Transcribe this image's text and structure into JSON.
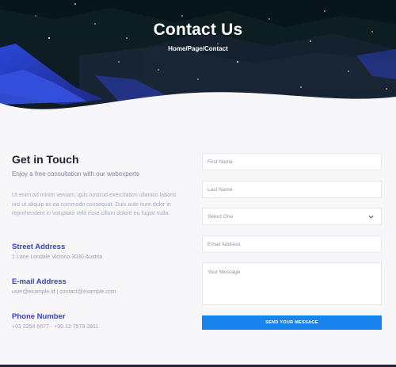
{
  "hero": {
    "title": "Contact Us",
    "breadcrumb": "Home/Page/Contact"
  },
  "contact_info": {
    "title": "Get in Touch",
    "subtitle": "Enjoy a free consultation with our webexperts",
    "body": "Ut enim ad minim veniam, quis nostrud exercitation ullamco laboris nisi ut aliquip ex ea commodo consequat. Duis aute irure dolor in reprehenderit in voluptate velit esse cillum dolore eu fugiat nulla.",
    "street_label": "Street Address",
    "street_value": "1 Lane Londale Victoria 3030 Austria",
    "email_label": "E-mail Address",
    "email_value": "user@example.id | contact@example.com",
    "phone_label": "Phone Number",
    "phone_value": "+01 3254 6677 · +00 12 7579 2811"
  },
  "form": {
    "name_placeholder": "First Name",
    "lastname_placeholder": "Last Name",
    "select_label": "Select One",
    "email_placeholder": "Email Address",
    "message_placeholder": "Your Message",
    "send_label": "SEND YOUR MESSAGE"
  },
  "colors": {
    "accent": "#3c3fbf",
    "button": "#1a84ee",
    "hero_dark": "#0c1a1e",
    "hero_blue": "#2b3fc4"
  }
}
